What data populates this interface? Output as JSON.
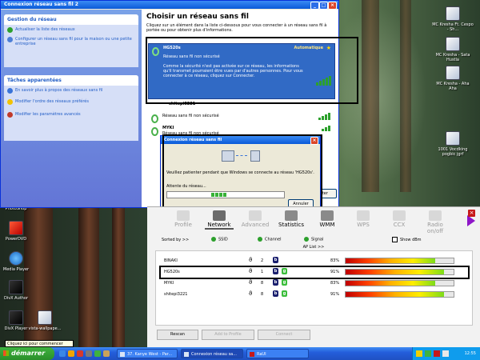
{
  "colors": {
    "xp_blue": "#0a5ad8",
    "selected": "#316ac5",
    "link": "#215dc6",
    "signal_green": "#2ca02c",
    "close_red": "#c61919"
  },
  "wireless_window": {
    "title": "Connexion réseau sans fil 2",
    "tasks": {
      "network_header": "Gestion du réseau",
      "network_items": [
        {
          "label": "Actualiser la liste des réseaux",
          "icon": "refresh-icon"
        },
        {
          "label": "Configurer un réseau sans fil pour la maison ou une petite entreprise",
          "icon": "setup-icon"
        }
      ],
      "related_header": "Tâches apparentées",
      "related_items": [
        {
          "label": "En savoir plus à propos des réseaux sans fil",
          "icon": "info-icon"
        },
        {
          "label": "Modifier l'ordre des réseaux préférés",
          "icon": "star-icon"
        },
        {
          "label": "Modifier les paramètres avancés",
          "icon": "settings-icon"
        }
      ]
    },
    "heading": "Choisir un réseau sans fil",
    "description": "Cliquez sur un élément dans la liste ci-dessous pour vous connecter à un réseau sans fil à portée ou pour obtenir plus d'informations.",
    "networks": [
      {
        "name": "HG520s",
        "status": "Automatique",
        "line1": "Réseau sans fil non sécurisé",
        "line2": "Comme la sécurité n'est pas activée sur ce réseau, les informations qu'il transmet pourraient être vues par d'autres personnes. Pour vous connecter à ce réseau, cliquez sur Connecter.",
        "signal": 5
      },
      {
        "name": "shitepi3221",
        "line1": "",
        "signal": 3
      },
      {
        "name": "",
        "line1": "Réseau sans fil non sécurisé",
        "signal": 4
      },
      {
        "name": "MYKI",
        "line1": "Réseau sans fil non sécurisé",
        "signal": 3
      }
    ]
  },
  "connect_dialog": {
    "title": "Connexion réseau sans fil",
    "message": "Veuillez patienter pendant que Windows se connecte au réseau 'HG520s'.",
    "waiting": "Attente du réseau...",
    "cancel": "Annuler",
    "behind_button": "cter",
    "progress": 0.55
  },
  "ralink": {
    "tabs": [
      {
        "label": "Profile",
        "icon": "profile-icon",
        "state": "dim"
      },
      {
        "label": "Network",
        "icon": "network-icon",
        "state": "active"
      },
      {
        "label": "Advanced",
        "icon": "advanced-icon",
        "state": "dim"
      },
      {
        "label": "Statistics",
        "icon": "statistics-icon",
        "state": "bold"
      },
      {
        "label": "WMM",
        "icon": "wmm-icon",
        "state": "bold"
      },
      {
        "label": "WPS",
        "icon": "wps-icon",
        "state": "dim"
      },
      {
        "label": "CCX",
        "icon": "ccx-icon",
        "state": "dim"
      },
      {
        "label": "Radio on/off",
        "icon": "radio-icon",
        "state": "dim"
      }
    ],
    "sorted_by": "Sorted by >>",
    "sort_ssid": "SSID",
    "sort_channel": "Channel",
    "sort_signal": "Signal",
    "show_dbm": "Show dBm",
    "ap_list_label": "AP List >>",
    "ap_list": [
      {
        "ssid": "BINAKI",
        "channel": "2",
        "b": "b",
        "g": "",
        "signal": 83
      },
      {
        "ssid": "HG520s",
        "channel": "1",
        "b": "b",
        "g": "g",
        "signal": 91
      },
      {
        "ssid": "MYKI",
        "channel": "8",
        "b": "b",
        "g": "g",
        "signal": 83
      },
      {
        "ssid": "shitepi3221",
        "channel": "8",
        "b": "b",
        "g": "g",
        "signal": 91
      }
    ],
    "pct_suffix": "%",
    "buttons": {
      "rescan": "Rescan",
      "add_profile": "Add to Profile",
      "connect": "Connect"
    }
  },
  "desktop": {
    "icons_right": [
      "MC Kresha Ft. Cespo - Sh...",
      "MC Kresha - Sata Hustla",
      "MC Kresha - Aha Aha",
      "1001 Vocdking pogbic jgrf"
    ],
    "icons_left": [
      "PhotoShop",
      "PowerDVD",
      "Media Player",
      "DivX Author",
      "DivX Player",
      "vista-wallpape..."
    ],
    "tooltip": "Cliquez ici pour commencer"
  },
  "taskbar": {
    "start": "démarrer",
    "items": [
      {
        "label": "37. Kanye West - Par...",
        "active": false
      },
      {
        "label": "Connexion réseau sa...",
        "active": true
      },
      {
        "label": "RaUI",
        "active": false
      }
    ],
    "clock": "12:55"
  }
}
